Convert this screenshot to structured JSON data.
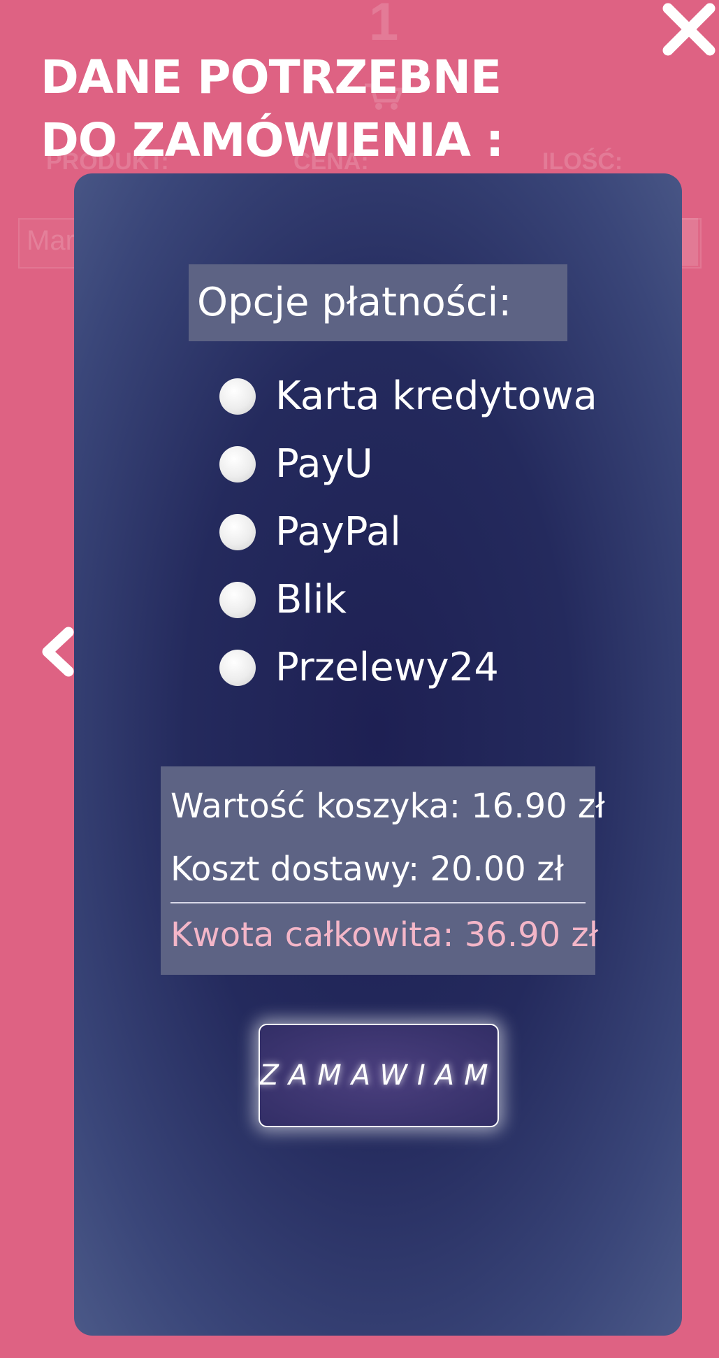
{
  "background": {
    "cart_count": "1",
    "columns": [
      "PRODUKT:",
      "CENA:",
      "ILOŚĆ:"
    ],
    "input_text": "Mar"
  },
  "header": {
    "title": "DANE POTRZEBNE DO ZAMÓWIENIA :"
  },
  "payment": {
    "title": "Opcje płatności:",
    "options": [
      {
        "label": "Karta kredytowa",
        "selected": false
      },
      {
        "label": "PayU",
        "selected": false
      },
      {
        "label": "PayPal",
        "selected": false
      },
      {
        "label": "Blik",
        "selected": false
      },
      {
        "label": "Przelewy24",
        "selected": false
      }
    ]
  },
  "summary": {
    "cart_value": "Wartość koszyka: 16.90 zł",
    "delivery_cost": "Koszt dostawy: 20.00 zł",
    "total": "Kwota całkowita: 36.90 zł"
  },
  "order_button": {
    "label": "ZAMAWIAM"
  },
  "colors": {
    "page_background": "#de6283",
    "modal_center": "#1e2053",
    "modal_edge": "#4b5988",
    "panel": "#5d6384",
    "total_text": "#f4b6c8"
  },
  "icons": {
    "close": "close-icon",
    "back": "chevron-left-icon",
    "cart": "cart-icon"
  }
}
